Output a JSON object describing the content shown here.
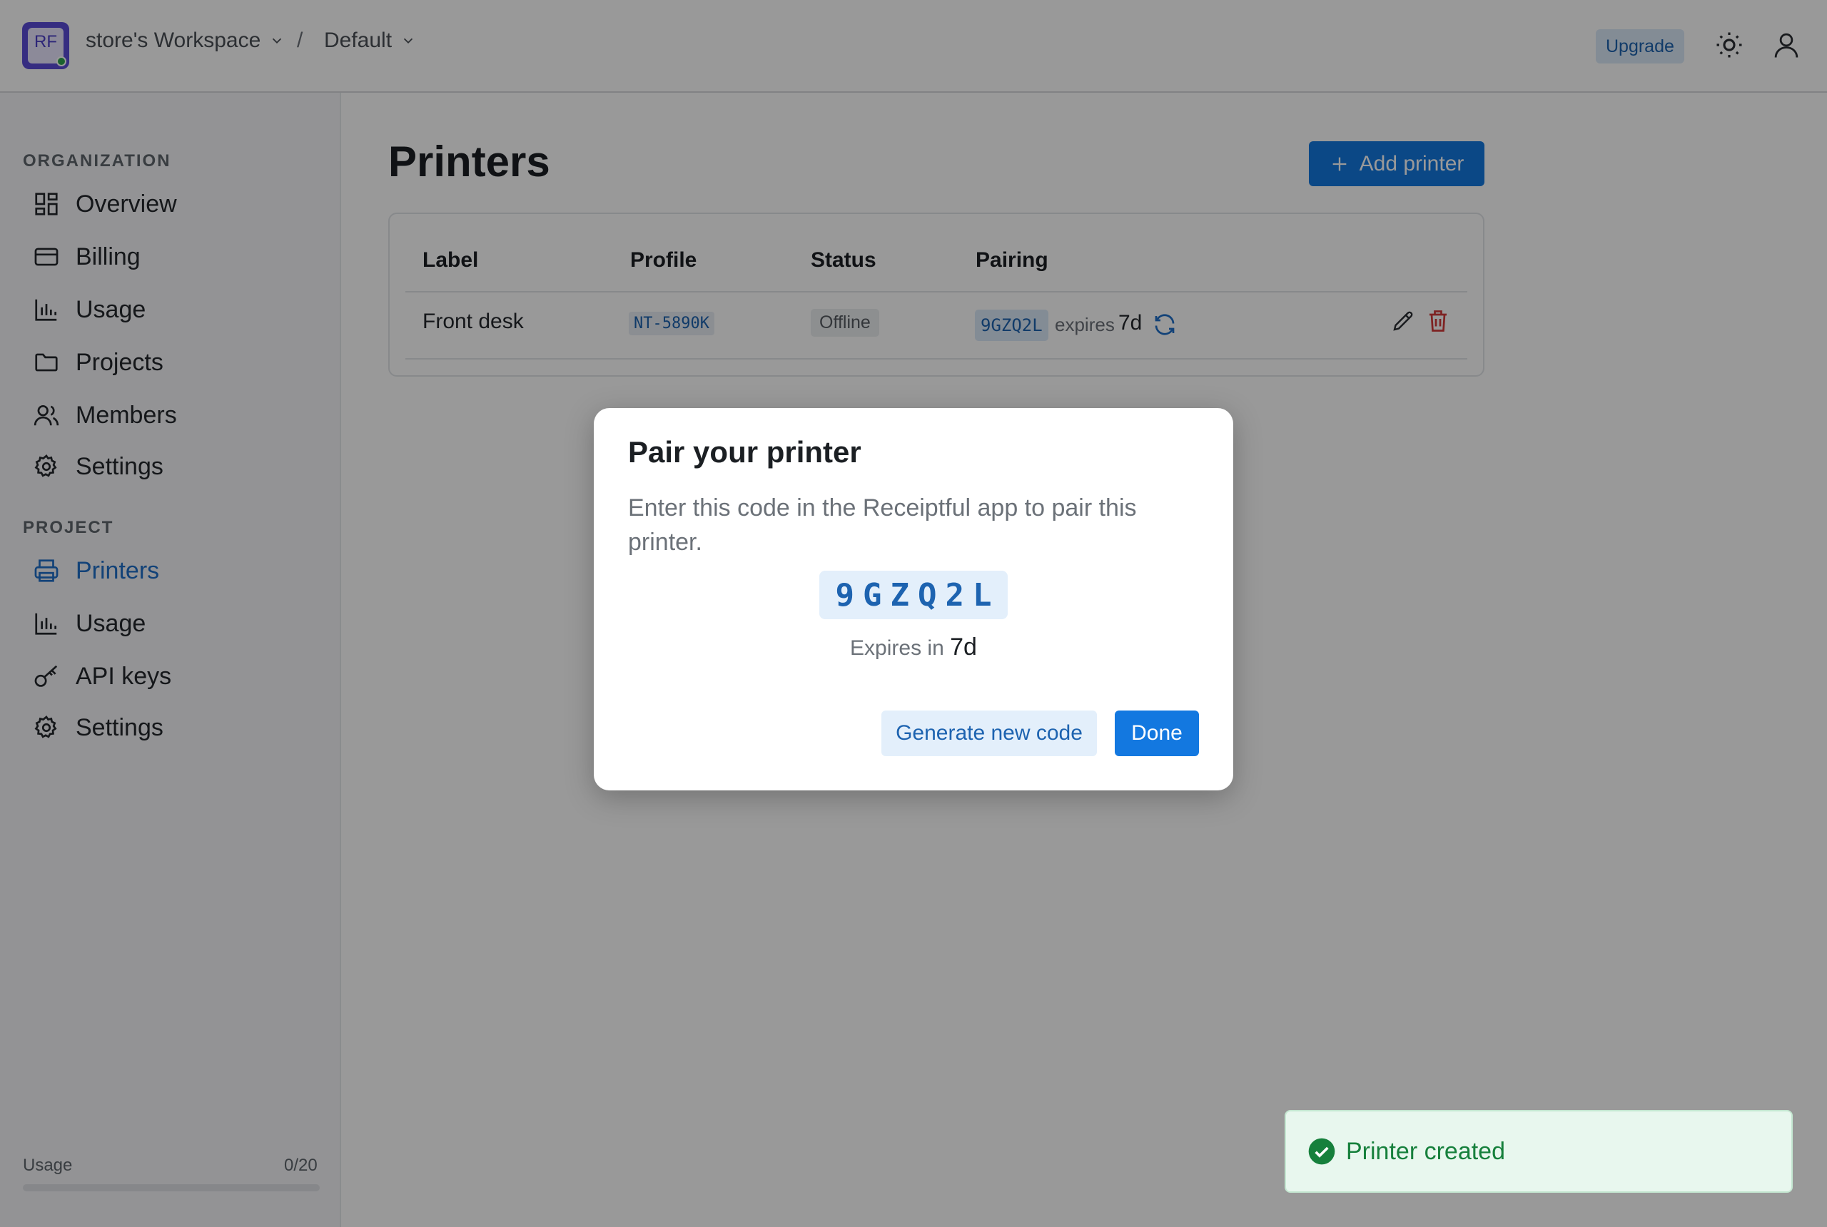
{
  "header": {
    "logo_text": "RF",
    "workspace": "store's Workspace",
    "separator": "/",
    "project": "Default",
    "upgrade_label": "Upgrade"
  },
  "sidebar": {
    "org_title": "ORGANIZATION",
    "org_items": [
      {
        "label": "Overview",
        "icon": "grid-icon"
      },
      {
        "label": "Billing",
        "icon": "credit-card-icon"
      },
      {
        "label": "Usage",
        "icon": "bar-chart-icon"
      },
      {
        "label": "Projects",
        "icon": "folder-icon"
      },
      {
        "label": "Members",
        "icon": "users-icon"
      },
      {
        "label": "Settings",
        "icon": "gear-icon"
      }
    ],
    "project_title": "PROJECT",
    "project_items": [
      {
        "label": "Printers",
        "icon": "printer-icon",
        "active": true
      },
      {
        "label": "Usage",
        "icon": "bar-chart-icon"
      },
      {
        "label": "API keys",
        "icon": "key-icon"
      },
      {
        "label": "Settings",
        "icon": "gear-icon"
      }
    ],
    "usage": {
      "label": "Usage",
      "count": "0/20",
      "fraction": 0
    }
  },
  "main": {
    "title": "Printers",
    "add_button": "Add printer",
    "table": {
      "columns": [
        "Label",
        "Profile",
        "Status",
        "Pairing"
      ],
      "rows": [
        {
          "label": "Front desk",
          "profile": "NT-5890K",
          "status": "Offline",
          "pairing_code": "9GZQ2L",
          "expires_label": "expires",
          "expires_value": "7d"
        }
      ]
    }
  },
  "modal": {
    "title": "Pair your printer",
    "description": "Enter this code in the Receiptful app to pair this printer.",
    "code": "9GZQ2L",
    "expires_label": "Expires in",
    "expires_value": "7d",
    "secondary_button": "Generate new code",
    "primary_button": "Done"
  },
  "toast": {
    "message": "Printer created"
  },
  "colors": {
    "accent": "#1378e0",
    "success": "#16803c",
    "danger": "#d23a3a"
  }
}
